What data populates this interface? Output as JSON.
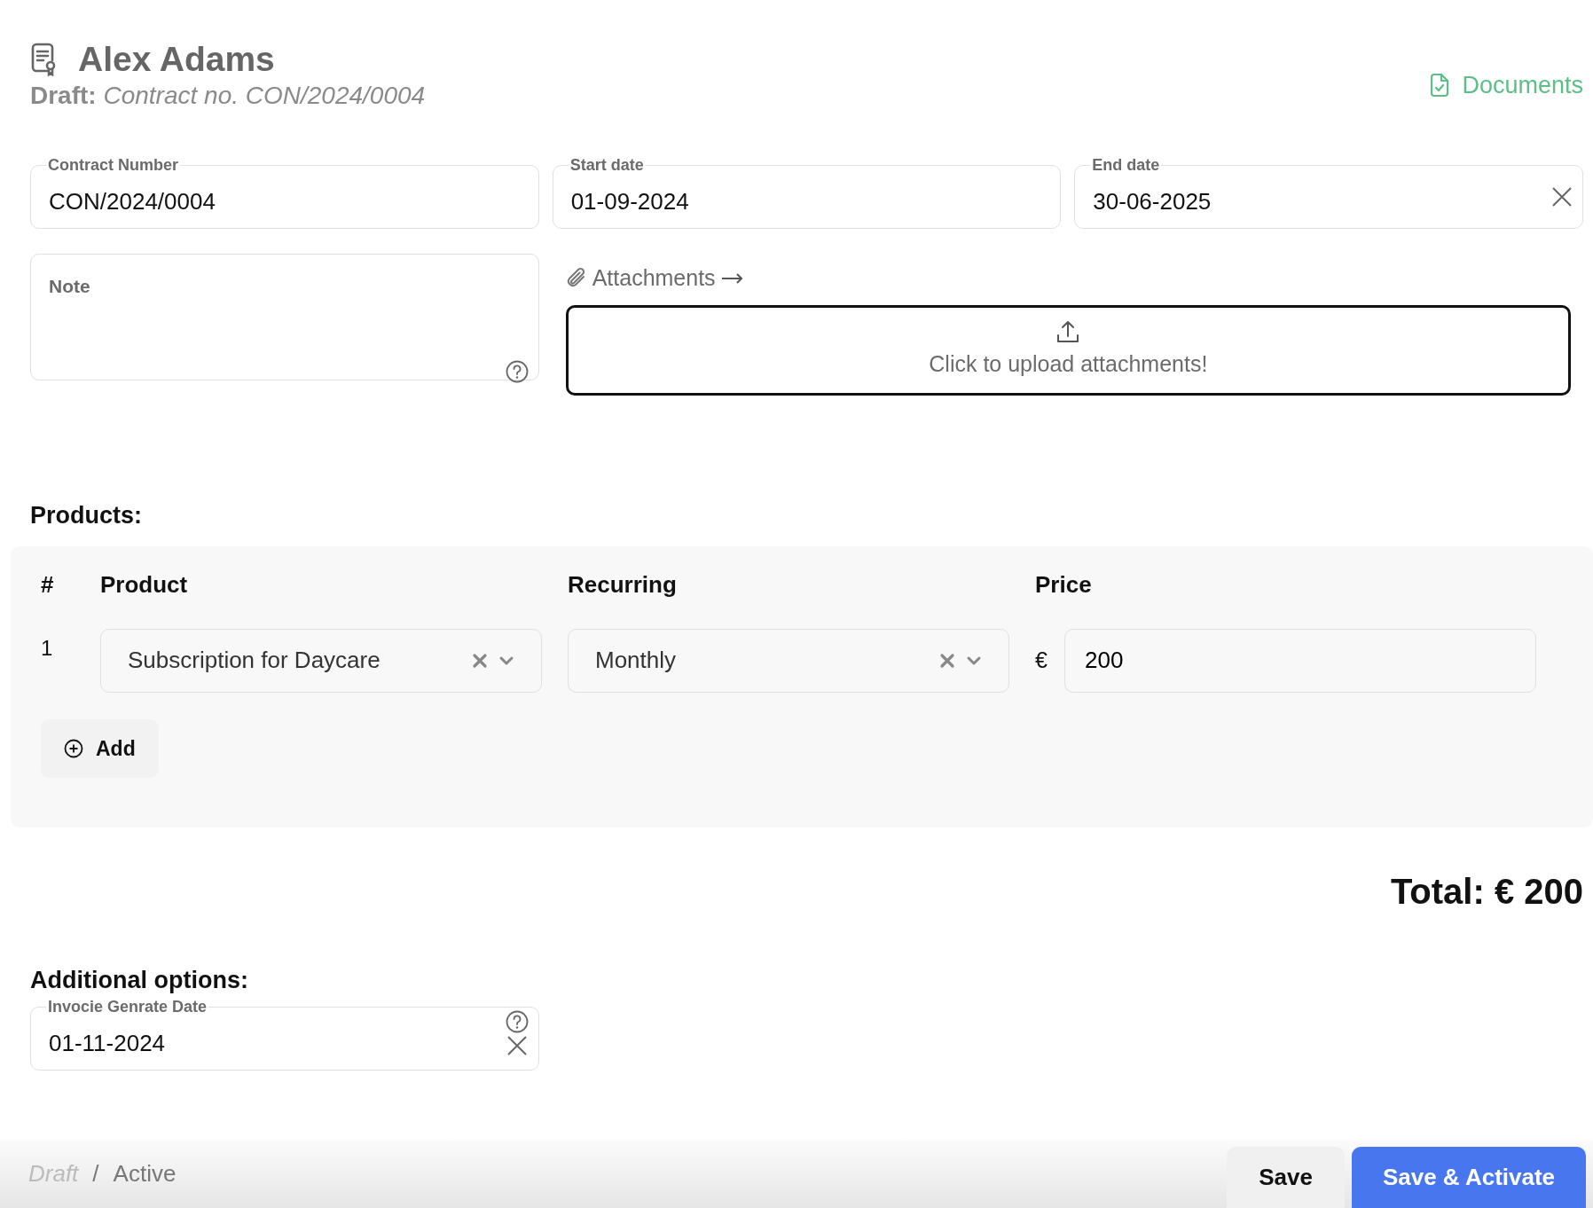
{
  "header": {
    "title": "Alex Adams",
    "subtitle": "**Draft:** *Contract no. CON/2024/0004*",
    "documents_link": "Documents"
  },
  "fields": [
    {
      "label": "Contract Number",
      "value": "CON/2024/0004",
      "clearable": false
    },
    {
      "label": "Start date",
      "value": "01-09-2024",
      "clearable": false
    },
    {
      "label": "End date",
      "value": "30-06-2025",
      "clearable": true
    }
  ],
  "note": {
    "placeholder": "Note",
    "help": true
  },
  "attachments": {
    "label": "Attachments",
    "upload_prompt": "Click to upload attachments!"
  },
  "products": {
    "heading": "Products:",
    "columns": [
      "#",
      "Product",
      "Recurring",
      "Price"
    ],
    "rows": [
      {
        "index": "1",
        "product": "Subscription for Daycare",
        "recurring": "Monthly",
        "currency": "€",
        "price": "200"
      }
    ],
    "add_button": "Add"
  },
  "total": "Total: € 200",
  "additional_options": {
    "heading": "Additional options:",
    "fields": [
      {
        "label": "Invocie Genrate Date",
        "value": "01-11-2024",
        "clearable": true,
        "help": true
      }
    ]
  },
  "footer": {
    "statuses": [
      {
        "label": "Draft",
        "selected": true
      },
      {
        "label": "Active",
        "selected": false
      }
    ],
    "separator": "/",
    "buttons": [
      {
        "label": "Save",
        "kind": "secondary"
      },
      {
        "label": "Save & Activate",
        "kind": "primary"
      }
    ]
  }
}
